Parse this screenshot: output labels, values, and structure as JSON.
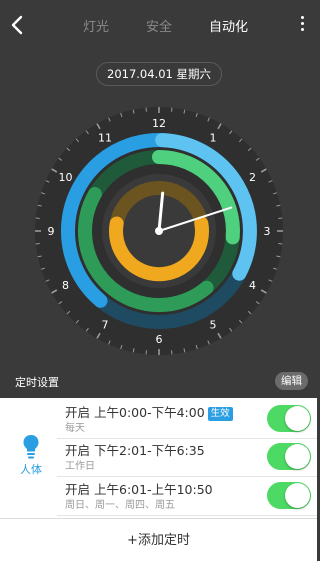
{
  "header": {
    "back_icon": "chevron-left-icon",
    "tabs": [
      {
        "label": "灯光",
        "active": false
      },
      {
        "label": "安全",
        "active": false
      },
      {
        "label": "自动化",
        "active": true
      }
    ],
    "more_icon": "vertical-dots-icon"
  },
  "date_label": "2017.04.01  星期六",
  "clock": {
    "numbers": [
      "12",
      "1",
      "2",
      "3",
      "4",
      "5",
      "6",
      "7",
      "8",
      "9",
      "10",
      "11"
    ],
    "time_hour": 12,
    "time_minute": 11,
    "ring_outer_color": "#2a9ee2",
    "ring_middle_color": "#3cc06a",
    "ring_inner_color": "#f5b324"
  },
  "section": {
    "title": "定时设置",
    "edit_label": "编辑"
  },
  "sensor": {
    "icon": "light-bulb-icon",
    "label": "人体"
  },
  "timers": [
    {
      "action": "开启",
      "range": "上午0:00-下午4:00",
      "badge": "生效",
      "repeat": "每天",
      "enabled": true
    },
    {
      "action": "开启",
      "range": "下午2:01-下午6:35",
      "badge": "",
      "repeat": "工作日",
      "enabled": true
    },
    {
      "action": "开启",
      "range": "上午6:01-上午10:50",
      "badge": "",
      "repeat": "周日、周一、周四、周五",
      "enabled": true
    }
  ],
  "add_label": "+添加定时",
  "colors": {
    "accent_blue": "#2a9ee2",
    "toggle_green": "#4cd964"
  }
}
